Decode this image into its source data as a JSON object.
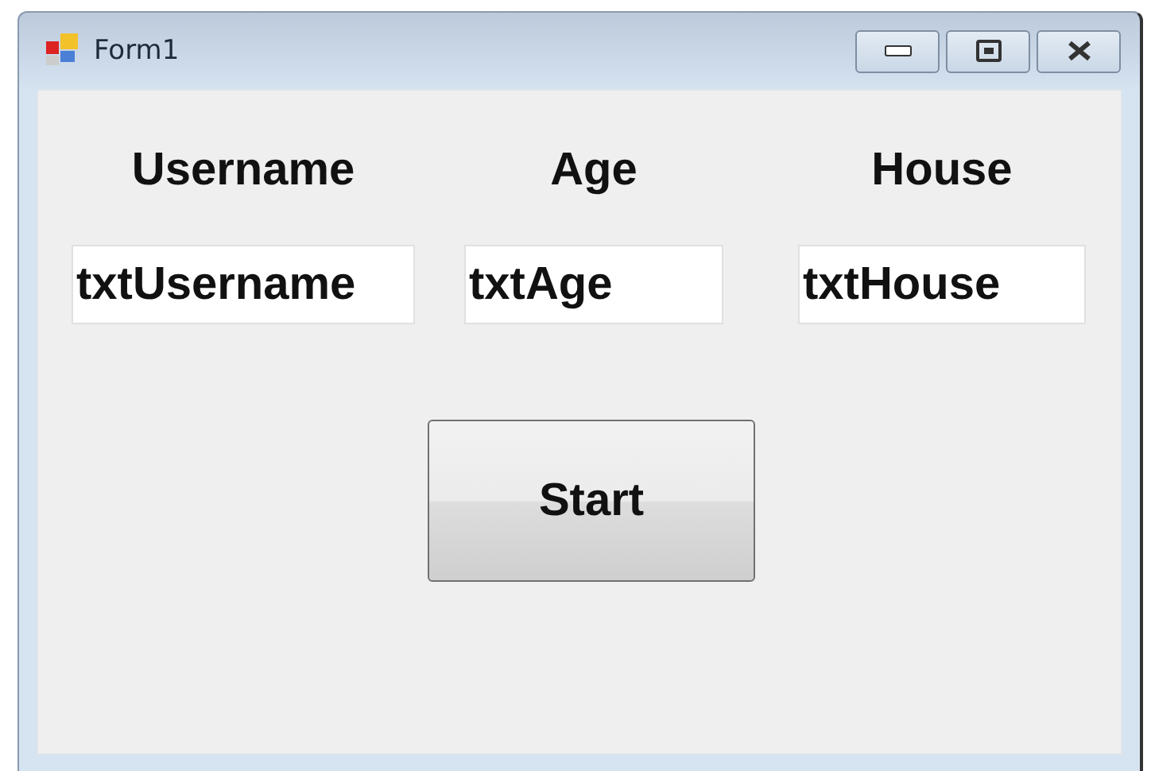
{
  "window": {
    "title": "Form1"
  },
  "fields": [
    {
      "label": "Username",
      "value": "txtUsername"
    },
    {
      "label": "Age",
      "value": "txtAge"
    },
    {
      "label": "House",
      "value": "txtHouse"
    }
  ],
  "button": {
    "label": "Start"
  }
}
